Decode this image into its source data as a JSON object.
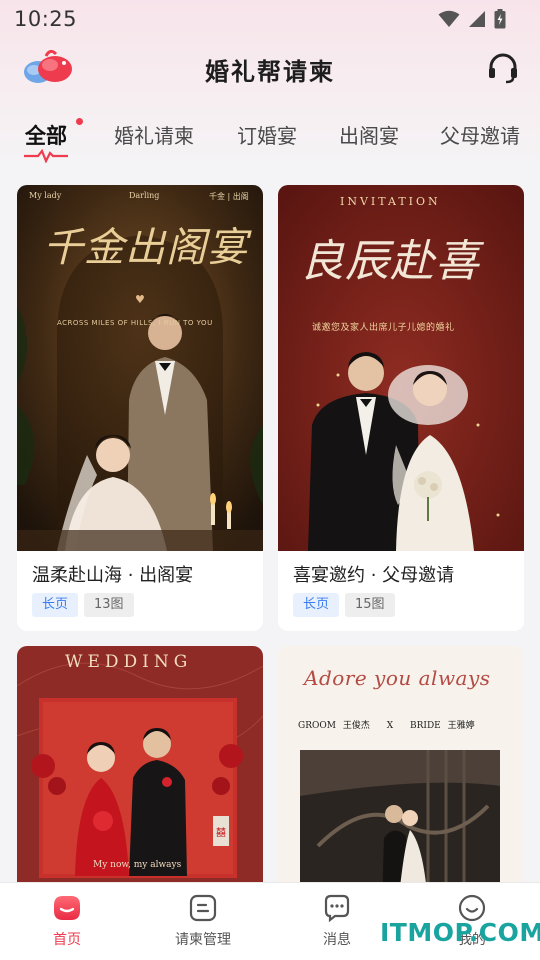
{
  "status_bar": {
    "time": "10:25"
  },
  "header": {
    "title": "婚礼帮请柬"
  },
  "tabs": [
    {
      "label": "全部",
      "active": true
    },
    {
      "label": "婚礼请柬"
    },
    {
      "label": "订婚宴"
    },
    {
      "label": "出阁宴"
    },
    {
      "label": "父母邀请"
    }
  ],
  "cards": [
    {
      "title": "温柔赴山海 · 出阁宴",
      "tags": [
        "长页",
        "13图"
      ],
      "art": {
        "headline": "千金出阁宴",
        "small_top_left": "My lady",
        "small_top_center": "Darling",
        "small_top_right": "千金 | 出阁",
        "subtitle": "ACROSS MILES OF HILLS, I RUN TO YOU"
      }
    },
    {
      "title": "喜宴邀约 · 父母邀请",
      "tags": [
        "长页",
        "15图"
      ],
      "art": {
        "kicker": "INVITATION",
        "headline": "良辰赴喜",
        "subtitle": "诚邀您及家人出席儿子儿媳的婚礼"
      }
    },
    {
      "title": "",
      "tags": [],
      "art": {
        "headline": "WEDDING",
        "footer": "My now, my always"
      }
    },
    {
      "title": "",
      "tags": [],
      "art": {
        "headline": "Adore you always",
        "groom_label": "GROOM",
        "groom_name": "王俊杰",
        "x": "X",
        "bride_label": "BRIDE",
        "bride_name": "王雅婷"
      }
    }
  ],
  "tab_bar": [
    {
      "label": "首页",
      "icon": "home-icon",
      "active": true
    },
    {
      "label": "请柬管理",
      "icon": "manage-icon"
    },
    {
      "label": "消息",
      "icon": "message-icon"
    },
    {
      "label": "我的",
      "icon": "profile-icon"
    }
  ],
  "watermark": "ITMOP.COM",
  "colors": {
    "accent": "#ee3b4e",
    "tag_blue": "#3a7cf0",
    "watermark": "#1aa4a0"
  }
}
